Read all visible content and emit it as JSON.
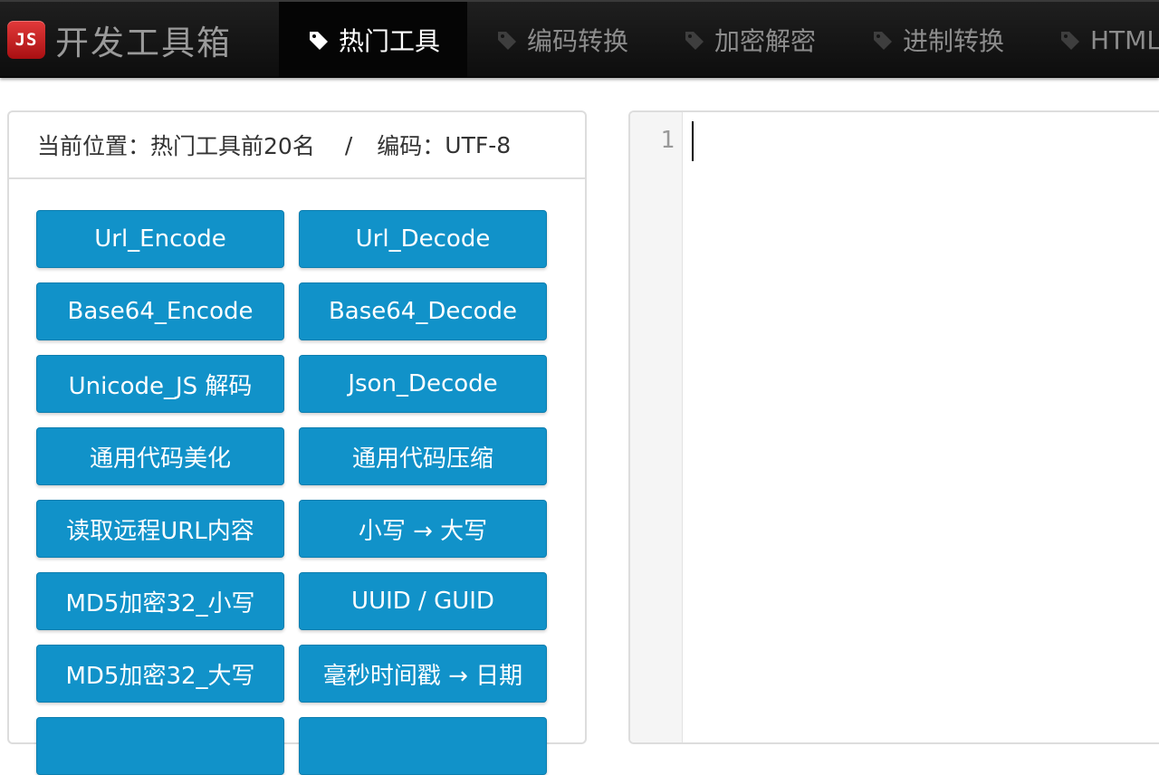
{
  "app": {
    "logo_text": "JS",
    "title": "开发工具箱"
  },
  "nav": {
    "tabs": [
      {
        "label": "热门工具",
        "icon": "tag-icon",
        "active": true
      },
      {
        "label": "编码转换",
        "icon": "tag-icon",
        "active": false
      },
      {
        "label": "加密解密",
        "icon": "tag-icon",
        "active": false
      },
      {
        "label": "进制转换",
        "icon": "tag-icon",
        "active": false
      },
      {
        "label": "HTML",
        "icon": "tag-icon",
        "active": false
      }
    ]
  },
  "panel": {
    "location_label": "当前位置：",
    "location_value": "热门工具前20名",
    "separator": "/",
    "encoding_label": "编码：",
    "encoding_value": "UTF-8"
  },
  "tools": [
    "Url_Encode",
    "Url_Decode",
    "Base64_Encode",
    "Base64_Decode",
    "Unicode_JS 解码",
    "Json_Decode",
    "通用代码美化",
    "通用代码压缩",
    "读取远程URL内容",
    "小写 → 大写",
    "MD5加密32_小写",
    "UUID / GUID",
    "MD5加密32_大写",
    "毫秒时间戳 → 日期",
    "",
    ""
  ],
  "editor": {
    "line_number": "1"
  },
  "colors": {
    "navbar": "#111111",
    "button": "#1192c9",
    "logo": "#c0181c"
  }
}
